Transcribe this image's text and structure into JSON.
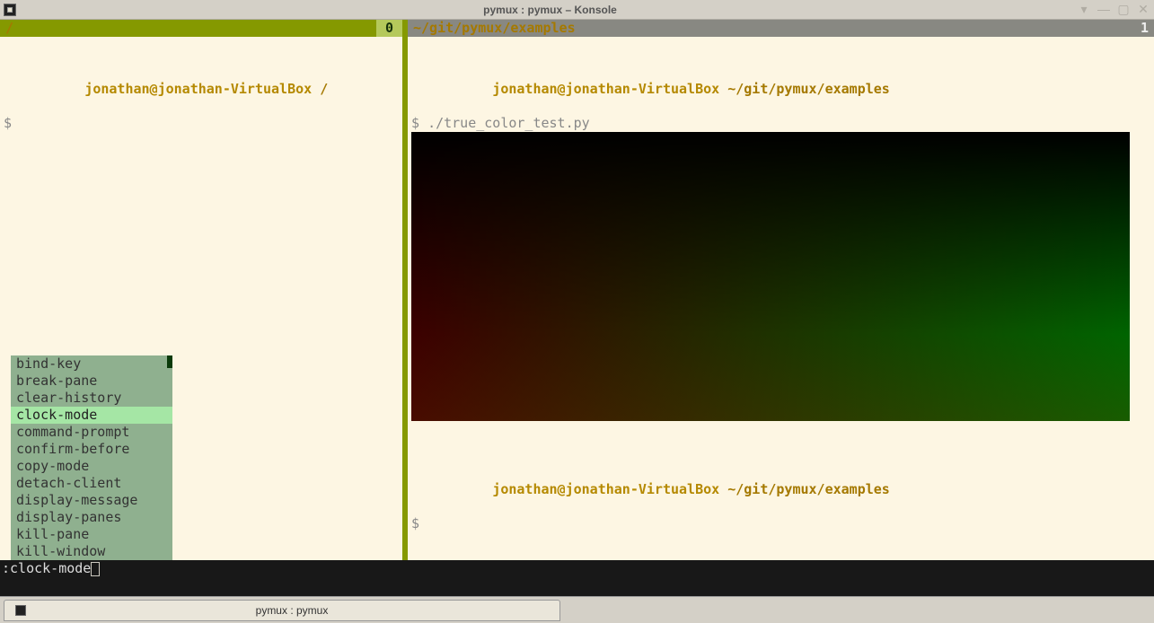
{
  "window": {
    "title": "pymux : pymux – Konsole"
  },
  "panes": {
    "left": {
      "title": "/",
      "index": "0",
      "prompt_user": "jonathan@jonathan-VirtualBox",
      "prompt_path": "/",
      "prompt_symbol": "$ "
    },
    "right": {
      "title": "~/git/pymux/examples",
      "index": "1",
      "prompt_user": "jonathan@jonathan-VirtualBox",
      "prompt_path": "~/git/pymux/examples",
      "prompt_symbol": "$ ",
      "command": "./true_color_test.py",
      "prompt_user2": "jonathan@jonathan-VirtualBox",
      "prompt_path2": "~/git/pymux/examples",
      "prompt_symbol2": "$ "
    }
  },
  "completion": {
    "items": [
      "bind-key",
      "break-pane",
      "clear-history",
      "clock-mode",
      "command-prompt",
      "confirm-before",
      "copy-mode",
      "detach-client",
      "display-message",
      "display-panes",
      "kill-pane",
      "kill-window"
    ],
    "selected": "clock-mode"
  },
  "command_line": {
    "prefix": ":",
    "text": "clock-mode"
  },
  "tab": {
    "label": "pymux : pymux"
  }
}
